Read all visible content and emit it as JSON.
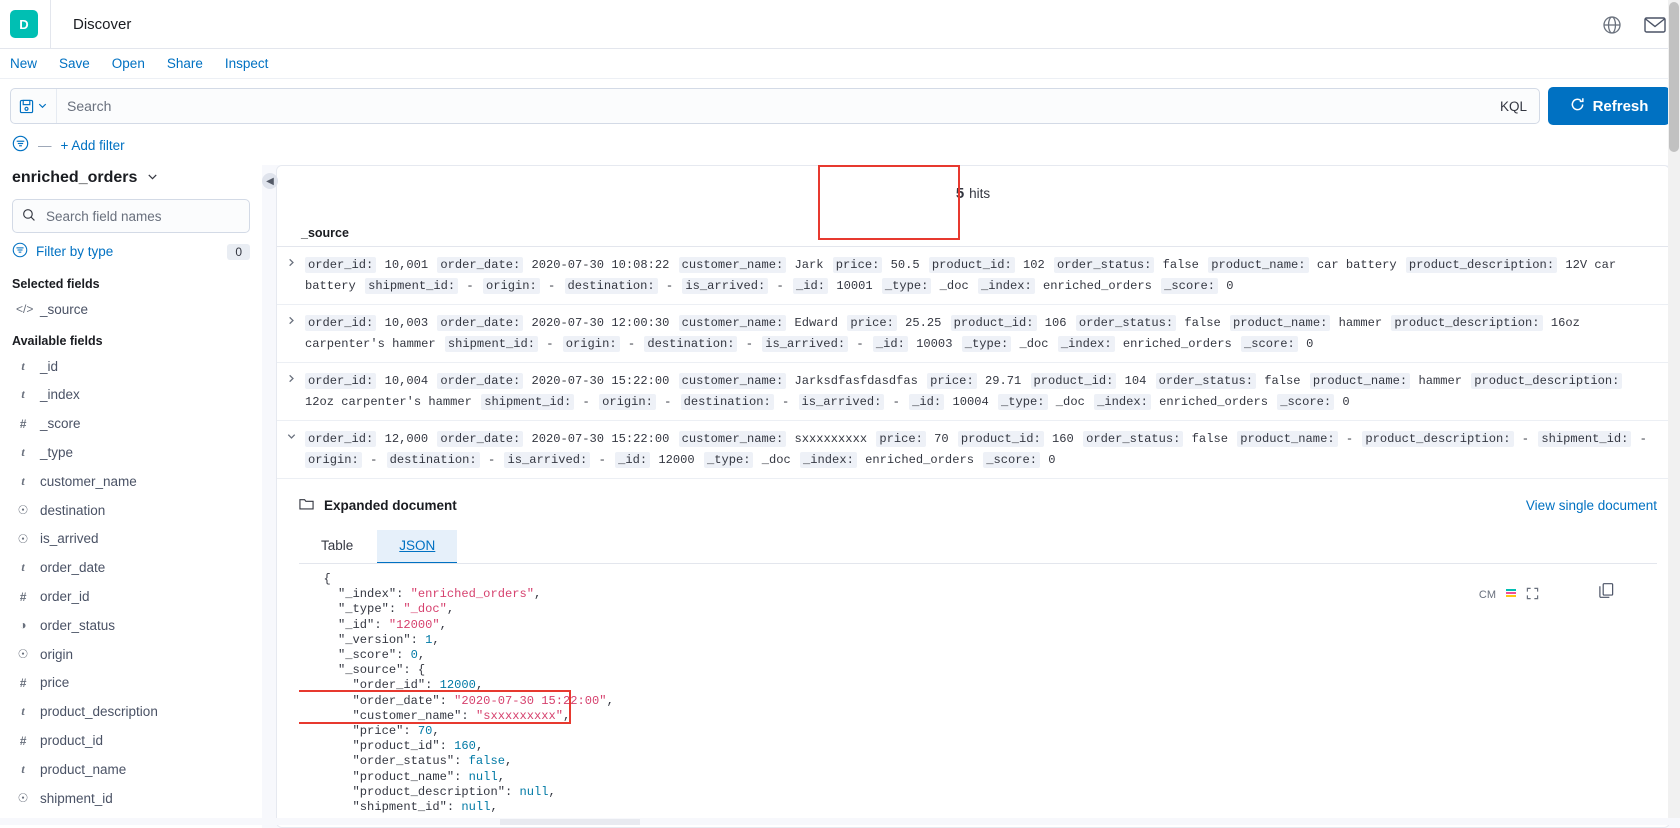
{
  "app": {
    "logo_letter": "D",
    "title": "Discover"
  },
  "topbar_icons": [
    {
      "name": "globe-icon",
      "glyph": "⊕"
    },
    {
      "name": "mail-icon",
      "glyph": "✉"
    }
  ],
  "menu": {
    "items": [
      {
        "label": "New",
        "name": "menu-new"
      },
      {
        "label": "Save",
        "name": "menu-save"
      },
      {
        "label": "Open",
        "name": "menu-open"
      },
      {
        "label": "Share",
        "name": "menu-share"
      },
      {
        "label": "Inspect",
        "name": "menu-inspect"
      }
    ]
  },
  "query_bar": {
    "search_placeholder": "Search",
    "search_value": "",
    "language_badge": "KQL",
    "refresh_label": "Refresh"
  },
  "filter_bar": {
    "dash": "—",
    "add_filter_label": "+ Add filter"
  },
  "sidebar": {
    "index_pattern": "enriched_orders",
    "field_search_placeholder": "Search field names",
    "filter_by_type_label": "Filter by type",
    "filter_by_type_count": "0",
    "selected_fields_title": "Selected fields",
    "available_fields_title": "Available fields",
    "selected_fields": [
      {
        "name": "_source",
        "type": "source"
      }
    ],
    "available_fields": [
      {
        "name": "_id",
        "type": "string"
      },
      {
        "name": "_index",
        "type": "string"
      },
      {
        "name": "_score",
        "type": "number"
      },
      {
        "name": "_type",
        "type": "string"
      },
      {
        "name": "customer_name",
        "type": "string"
      },
      {
        "name": "destination",
        "type": "unknown"
      },
      {
        "name": "is_arrived",
        "type": "unknown"
      },
      {
        "name": "order_date",
        "type": "string"
      },
      {
        "name": "order_id",
        "type": "number"
      },
      {
        "name": "order_status",
        "type": "boolean"
      },
      {
        "name": "origin",
        "type": "unknown"
      },
      {
        "name": "price",
        "type": "number"
      },
      {
        "name": "product_description",
        "type": "string"
      },
      {
        "name": "product_id",
        "type": "number"
      },
      {
        "name": "product_name",
        "type": "string"
      },
      {
        "name": "shipment_id",
        "type": "unknown"
      }
    ]
  },
  "results": {
    "hits_count": "5",
    "hits_label": "hits",
    "column_header": "_source",
    "rows": [
      {
        "expanded": false,
        "fields": [
          {
            "k": "order_id:",
            "v": "10,001"
          },
          {
            "k": "order_date:",
            "v": "2020-07-30 10:08:22"
          },
          {
            "k": "customer_name:",
            "v": "Jark"
          },
          {
            "k": "price:",
            "v": "50.5"
          },
          {
            "k": "product_id:",
            "v": "102"
          },
          {
            "k": "order_status:",
            "v": "false"
          },
          {
            "k": "product_name:",
            "v": "car battery"
          },
          {
            "k": "product_description:",
            "v": "12V car battery"
          },
          {
            "k": "shipment_id:",
            "v": "-"
          },
          {
            "k": "origin:",
            "v": "-"
          },
          {
            "k": "destination:",
            "v": "-"
          },
          {
            "k": "is_arrived:",
            "v": "-"
          },
          {
            "k": "_id:",
            "v": "10001"
          },
          {
            "k": "_type:",
            "v": "_doc"
          },
          {
            "k": "_index:",
            "v": "enriched_orders"
          },
          {
            "k": "_score:",
            "v": "0"
          }
        ]
      },
      {
        "expanded": false,
        "fields": [
          {
            "k": "order_id:",
            "v": "10,003"
          },
          {
            "k": "order_date:",
            "v": "2020-07-30 12:00:30"
          },
          {
            "k": "customer_name:",
            "v": "Edward"
          },
          {
            "k": "price:",
            "v": "25.25"
          },
          {
            "k": "product_id:",
            "v": "106"
          },
          {
            "k": "order_status:",
            "v": "false"
          },
          {
            "k": "product_name:",
            "v": "hammer"
          },
          {
            "k": "product_description:",
            "v": "16oz carpenter's hammer"
          },
          {
            "k": "shipment_id:",
            "v": "-"
          },
          {
            "k": "origin:",
            "v": "-"
          },
          {
            "k": "destination:",
            "v": "-"
          },
          {
            "k": "is_arrived:",
            "v": "-"
          },
          {
            "k": "_id:",
            "v": "10003"
          },
          {
            "k": "_type:",
            "v": "_doc"
          },
          {
            "k": "_index:",
            "v": "enriched_orders"
          },
          {
            "k": "_score:",
            "v": "0"
          }
        ]
      },
      {
        "expanded": false,
        "fields": [
          {
            "k": "order_id:",
            "v": "10,004"
          },
          {
            "k": "order_date:",
            "v": "2020-07-30 15:22:00"
          },
          {
            "k": "customer_name:",
            "v": "Jarksdfasfdasdfas"
          },
          {
            "k": "price:",
            "v": "29.71"
          },
          {
            "k": "product_id:",
            "v": "104"
          },
          {
            "k": "order_status:",
            "v": "false"
          },
          {
            "k": "product_name:",
            "v": "hammer"
          },
          {
            "k": "product_description:",
            "v": "12oz carpenter's hammer"
          },
          {
            "k": "shipment_id:",
            "v": "-"
          },
          {
            "k": "origin:",
            "v": "-"
          },
          {
            "k": "destination:",
            "v": "-"
          },
          {
            "k": "is_arrived:",
            "v": "-"
          },
          {
            "k": "_id:",
            "v": "10004"
          },
          {
            "k": "_type:",
            "v": "_doc"
          },
          {
            "k": "_index:",
            "v": "enriched_orders"
          },
          {
            "k": "_score:",
            "v": "0"
          }
        ]
      },
      {
        "expanded": true,
        "fields": [
          {
            "k": "order_id:",
            "v": "12,000"
          },
          {
            "k": "order_date:",
            "v": "2020-07-30 15:22:00"
          },
          {
            "k": "customer_name:",
            "v": "sxxxxxxxxx"
          },
          {
            "k": "price:",
            "v": "70"
          },
          {
            "k": "product_id:",
            "v": "160"
          },
          {
            "k": "order_status:",
            "v": "false"
          },
          {
            "k": "product_name:",
            "v": "-"
          },
          {
            "k": "product_description:",
            "v": "-"
          },
          {
            "k": "shipment_id:",
            "v": "-"
          },
          {
            "k": "origin:",
            "v": "-"
          },
          {
            "k": "destination:",
            "v": "-"
          },
          {
            "k": "is_arrived:",
            "v": "-"
          },
          {
            "k": "_id:",
            "v": "12000"
          },
          {
            "k": "_type:",
            "v": "_doc"
          },
          {
            "k": "_index:",
            "v": "enriched_orders"
          },
          {
            "k": "_score:",
            "v": "0"
          }
        ]
      }
    ]
  },
  "expanded_document": {
    "title": "Expanded document",
    "view_single_label": "View single document",
    "tabs": [
      {
        "label": "Table",
        "active": false
      },
      {
        "label": "JSON",
        "active": true
      }
    ],
    "json_lines": [
      {
        "indent": 0,
        "segs": [
          {
            "t": "punct",
            "s": "{"
          }
        ]
      },
      {
        "indent": 1,
        "segs": [
          {
            "t": "key",
            "s": "\"_index\""
          },
          {
            "t": "punct",
            "s": ": "
          },
          {
            "t": "str",
            "s": "\"enriched_orders\""
          },
          {
            "t": "punct",
            "s": ","
          }
        ]
      },
      {
        "indent": 1,
        "segs": [
          {
            "t": "key",
            "s": "\"_type\""
          },
          {
            "t": "punct",
            "s": ": "
          },
          {
            "t": "str",
            "s": "\"_doc\""
          },
          {
            "t": "punct",
            "s": ","
          }
        ]
      },
      {
        "indent": 1,
        "segs": [
          {
            "t": "key",
            "s": "\"_id\""
          },
          {
            "t": "punct",
            "s": ": "
          },
          {
            "t": "str",
            "s": "\"12000\""
          },
          {
            "t": "punct",
            "s": ","
          }
        ]
      },
      {
        "indent": 1,
        "segs": [
          {
            "t": "key",
            "s": "\"_version\""
          },
          {
            "t": "punct",
            "s": ": "
          },
          {
            "t": "num",
            "s": "1"
          },
          {
            "t": "punct",
            "s": ","
          }
        ]
      },
      {
        "indent": 1,
        "segs": [
          {
            "t": "key",
            "s": "\"_score\""
          },
          {
            "t": "punct",
            "s": ": "
          },
          {
            "t": "num",
            "s": "0"
          },
          {
            "t": "punct",
            "s": ","
          }
        ]
      },
      {
        "indent": 1,
        "segs": [
          {
            "t": "key",
            "s": "\"_source\""
          },
          {
            "t": "punct",
            "s": ": {"
          }
        ]
      },
      {
        "indent": 2,
        "segs": [
          {
            "t": "key",
            "s": "\"order_id\""
          },
          {
            "t": "punct",
            "s": ": "
          },
          {
            "t": "num",
            "s": "12000"
          },
          {
            "t": "punct",
            "s": ","
          }
        ]
      },
      {
        "indent": 2,
        "segs": [
          {
            "t": "key",
            "s": "\"order_date\""
          },
          {
            "t": "punct",
            "s": ": "
          },
          {
            "t": "str",
            "s": "\"2020-07-30 15:22:00\""
          },
          {
            "t": "punct",
            "s": ","
          }
        ]
      },
      {
        "indent": 2,
        "segs": [
          {
            "t": "key",
            "s": "\"customer_name\""
          },
          {
            "t": "punct",
            "s": ": "
          },
          {
            "t": "str",
            "s": "\"sxxxxxxxxx\""
          },
          {
            "t": "punct",
            "s": ","
          }
        ]
      },
      {
        "indent": 2,
        "segs": [
          {
            "t": "key",
            "s": "\"price\""
          },
          {
            "t": "punct",
            "s": ": "
          },
          {
            "t": "num",
            "s": "70"
          },
          {
            "t": "punct",
            "s": ","
          }
        ]
      },
      {
        "indent": 2,
        "segs": [
          {
            "t": "key",
            "s": "\"product_id\""
          },
          {
            "t": "punct",
            "s": ": "
          },
          {
            "t": "num",
            "s": "160"
          },
          {
            "t": "punct",
            "s": ","
          }
        ]
      },
      {
        "indent": 2,
        "segs": [
          {
            "t": "key",
            "s": "\"order_status\""
          },
          {
            "t": "punct",
            "s": ": "
          },
          {
            "t": "bool",
            "s": "false"
          },
          {
            "t": "punct",
            "s": ","
          }
        ]
      },
      {
        "indent": 2,
        "segs": [
          {
            "t": "key",
            "s": "\"product_name\""
          },
          {
            "t": "punct",
            "s": ": "
          },
          {
            "t": "null",
            "s": "null"
          },
          {
            "t": "punct",
            "s": ","
          }
        ]
      },
      {
        "indent": 2,
        "segs": [
          {
            "t": "key",
            "s": "\"product_description\""
          },
          {
            "t": "punct",
            "s": ": "
          },
          {
            "t": "null",
            "s": "null"
          },
          {
            "t": "punct",
            "s": ","
          }
        ]
      },
      {
        "indent": 2,
        "segs": [
          {
            "t": "key",
            "s": "\"shipment_id\""
          },
          {
            "t": "punct",
            "s": ": "
          },
          {
            "t": "null",
            "s": "null"
          },
          {
            "t": "punct",
            "s": ","
          }
        ]
      }
    ],
    "toolbar": {
      "wrap_label": "CM",
      "fullscreen_glyph": "⛶",
      "copy_glyph": "⎘"
    }
  },
  "colors": {
    "accent": "#0071c2",
    "brand": "#00bfb3",
    "highlight": "#e7392f",
    "page_bg": "#f7f8fc"
  }
}
